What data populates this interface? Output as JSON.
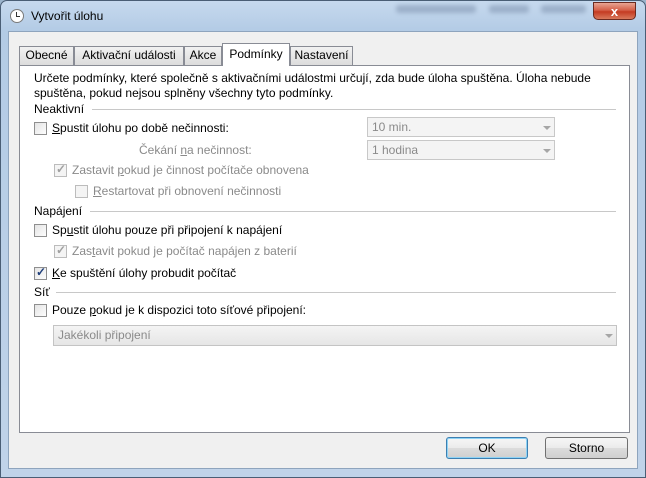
{
  "window": {
    "title": "Vytvořit úlohu",
    "close_glyph": "x"
  },
  "tabs": [
    {
      "label": "Obecné"
    },
    {
      "label": "Aktivační události"
    },
    {
      "label": "Akce"
    },
    {
      "label": "Podmínky"
    },
    {
      "label": "Nastavení"
    }
  ],
  "active_tab": "Podmínky",
  "description": "Určete podmínky, které společně s aktivačními událostmi určují, zda bude úloha spuštěna. Úloha nebude spuštěna, pokud nejsou splněny všechny tyto podmínky.",
  "idle": {
    "group_label": "Neaktivní",
    "start_if_idle": {
      "label_pre": "",
      "label_u": "S",
      "label_post": "pustit úlohu po době nečinnosti:",
      "checked": false
    },
    "idle_duration": {
      "value": "10 min."
    },
    "wait_label_pre": "Čekání ",
    "wait_label_u": "n",
    "wait_label_post": "a nečinnost:",
    "wait_duration": {
      "value": "1 hodina"
    },
    "stop_on_resume": {
      "label_pre": "Zastavit ",
      "label_u": "p",
      "label_post": "okud je činnost počítače obnovena",
      "checked": true
    },
    "restart_on_idle": {
      "label_pre": "",
      "label_u": "R",
      "label_post": "estartovat při obnovení nečinnosti",
      "checked": false
    }
  },
  "power": {
    "group_label": "Napájení",
    "ac_only": {
      "label_pre": "Sp",
      "label_u": "u",
      "label_post": "stit úlohu pouze při připojení k napájení",
      "checked": false
    },
    "stop_on_battery": {
      "label_pre": "Zas",
      "label_u": "t",
      "label_post": "avit pokud je počítač napájen z baterií",
      "checked": true
    },
    "wake": {
      "label_pre": "",
      "label_u": "K",
      "label_post": "e spuštění úlohy probudit počítač",
      "checked": true
    }
  },
  "network": {
    "group_label": "Síť",
    "only_if_network": {
      "label_pre": "Pouze ",
      "label_u": "p",
      "label_post": "okud je k dispozici toto síťové připojení:",
      "checked": false
    },
    "connection": {
      "value": "Jakékoli připojení"
    }
  },
  "buttons": {
    "ok": "OK",
    "cancel": "Storno"
  },
  "colors": {
    "checkmark": "#1f3f7a",
    "default_button_border": "#3c7fb1"
  }
}
